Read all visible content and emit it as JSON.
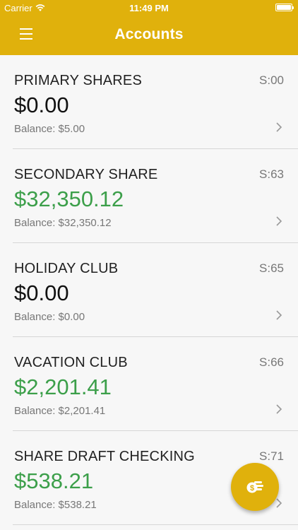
{
  "status_bar": {
    "carrier": "Carrier",
    "time": "11:49 PM"
  },
  "nav": {
    "title": "Accounts",
    "menu_icon": "hamburger-menu-icon"
  },
  "accounts": [
    {
      "name": "PRIMARY SHARES",
      "code": "S:00",
      "amount": "$0.00",
      "balance": "Balance: $5.00",
      "positive": false
    },
    {
      "name": "SECONDARY SHARE",
      "code": "S:63",
      "amount": "$32,350.12",
      "balance": "Balance: $32,350.12",
      "positive": true
    },
    {
      "name": "HOLIDAY CLUB",
      "code": "S:65",
      "amount": "$0.00",
      "balance": "Balance: $0.00",
      "positive": false
    },
    {
      "name": "VACATION CLUB",
      "code": "S:66",
      "amount": "$2,201.41",
      "balance": "Balance: $2,201.41",
      "positive": true
    },
    {
      "name": "SHARE DRAFT CHECKING",
      "code": "S:71",
      "amount": "$538.21",
      "balance": "Balance: $538.21",
      "positive": true
    }
  ],
  "fab": {
    "icon": "coins-dollar-icon"
  },
  "colors": {
    "brand": "#e0b10c",
    "positive_amount": "#3c9f4a",
    "neutral_amount": "#111111"
  }
}
